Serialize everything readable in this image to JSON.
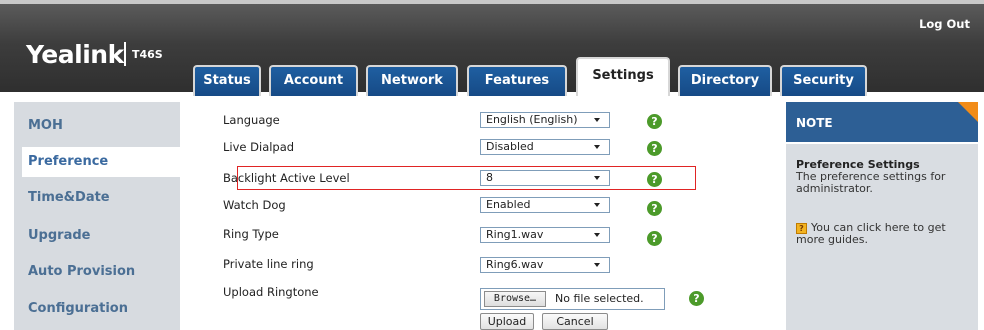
{
  "header": {
    "logo_text": "Yealink",
    "model": "T46S",
    "logout_label": "Log Out",
    "colors": {
      "accent_orange": "#f28c18",
      "tab_blue": "#1f5fa1",
      "header_dark": "#3d3d3d",
      "help_green": "#4c9a2a"
    }
  },
  "tabs": [
    {
      "label": "Status"
    },
    {
      "label": "Account"
    },
    {
      "label": "Network"
    },
    {
      "label": "Features"
    },
    {
      "label": "Settings",
      "active": true
    },
    {
      "label": "Directory"
    },
    {
      "label": "Security"
    }
  ],
  "sidebar": {
    "items": [
      {
        "label": "MOH"
      },
      {
        "label": "Preference",
        "active": true
      },
      {
        "label": "Time&Date"
      },
      {
        "label": "Upgrade"
      },
      {
        "label": "Auto Provision"
      },
      {
        "label": "Configuration"
      }
    ]
  },
  "form": {
    "rows": [
      {
        "label": "Language",
        "value": "English (English)"
      },
      {
        "label": "Live Dialpad",
        "value": "Disabled"
      },
      {
        "label": "Backlight Active Level",
        "value": "8",
        "highlighted": true
      },
      {
        "label": "Watch Dog",
        "value": "Enabled"
      },
      {
        "label": "Ring Type",
        "value": "Ring1.wav"
      },
      {
        "label": "Private line ring",
        "value": "Ring6.wav"
      }
    ],
    "upload_ringtone": {
      "label": "Upload Ringtone",
      "browse_label": "Browse…",
      "file_status": "No file selected.",
      "upload_label": "Upload",
      "cancel_label": "Cancel"
    },
    "help_glyph": "?"
  },
  "note": {
    "header": "NOTE",
    "title": "Preference Settings",
    "text": "The preference settings for administrator.",
    "guide_icon_glyph": "?",
    "guide_text": "You can click here to get more guides."
  }
}
